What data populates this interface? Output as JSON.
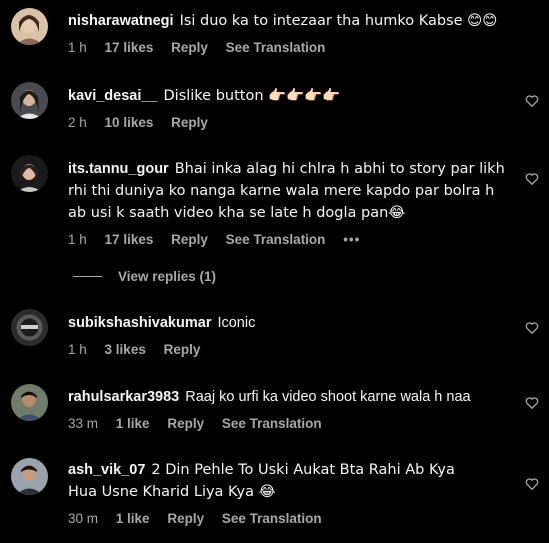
{
  "comments": [
    {
      "username": "nisharawatnegi",
      "text": "Isi duo ka to intezaar tha humko Kabse 😊😊",
      "time": "1 h",
      "likes": "17 likes",
      "reply": "Reply",
      "translate": "See Translation"
    },
    {
      "username": "kavi_desai__",
      "text": "Dislike button 👉🏻👉🏻👉🏻👉🏻",
      "time": "2 h",
      "likes": "10 likes",
      "reply": "Reply"
    },
    {
      "username": "its.tannu_gour",
      "text": "Bhai inka alag hi chlra h abhi to story par likh rhi thi duniya ko nanga karne wala mere kapdo par bolra h ab usi k saath video kha se late h dogla pan😂",
      "time": "1 h",
      "likes": "17 likes",
      "reply": "Reply",
      "translate": "See Translation",
      "more": "•••",
      "view_replies": "View replies (1)"
    },
    {
      "username": "subikshashivakumar",
      "text": "Iconic",
      "time": "1 h",
      "likes": "3 likes",
      "reply": "Reply"
    },
    {
      "username": "rahulsarkar3983",
      "text": "Raaj ko urfi ka video shoot karne wala h naa",
      "time": "33 m",
      "likes": "1 like",
      "reply": "Reply",
      "translate": "See Translation"
    },
    {
      "username": "ash_vik_07",
      "text": "2 Din Pehle To Uski Aukat Bta Rahi Ab Kya Hua Usne Kharid Liya Kya 😂",
      "time": "30 m",
      "likes": "1 like",
      "reply": "Reply",
      "translate": "See Translation"
    }
  ],
  "icons": {
    "like": "heart-outline-icon",
    "more": "more-options-icon"
  },
  "colors": {
    "background": "#000000",
    "primary_text": "#f5f5f5",
    "secondary_text": "#a8a8a8"
  }
}
